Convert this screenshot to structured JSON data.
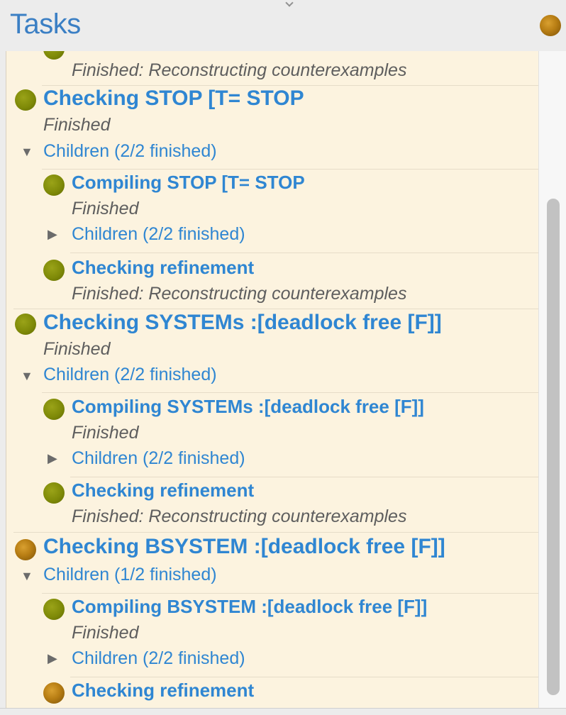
{
  "header": {
    "title": "Tasks",
    "status_icon": "running-status-icon"
  },
  "colors": {
    "done": "#7f8a08",
    "running": "#b87e14",
    "link": "#2f86d2",
    "panel_bg": "#fcf3df"
  },
  "rows": {
    "top_status": "Finished: Reconstructing counterexamples",
    "stop_title": "Checking STOP [T= STOP",
    "stop_status": "Finished",
    "stop_children": "Children (2/2 finished)",
    "stop_compile_title": "Compiling STOP [T= STOP",
    "stop_compile_status": "Finished",
    "stop_compile_children": "Children (2/2 finished)",
    "stop_refine_title": "Checking refinement",
    "stop_refine_status": "Finished: Reconstructing counterexamples",
    "systems_title": "Checking SYSTEMs :[deadlock free [F]]",
    "systems_status": "Finished",
    "systems_children": "Children (2/2 finished)",
    "systems_compile_title": "Compiling SYSTEMs :[deadlock free [F]]",
    "systems_compile_status": "Finished",
    "systems_compile_children": "Children (2/2 finished)",
    "systems_refine_title": "Checking refinement",
    "systems_refine_status": "Finished: Reconstructing counterexamples",
    "bsystem_title": "Checking BSYSTEM :[deadlock free [F]]",
    "bsystem_children": "Children (1/2 finished)",
    "bsystem_compile_title": "Compiling BSYSTEM :[deadlock free [F]]",
    "bsystem_compile_status": "Finished",
    "bsystem_compile_children": "Children (2/2 finished)",
    "bsystem_refine_title": "Checking refinement"
  }
}
